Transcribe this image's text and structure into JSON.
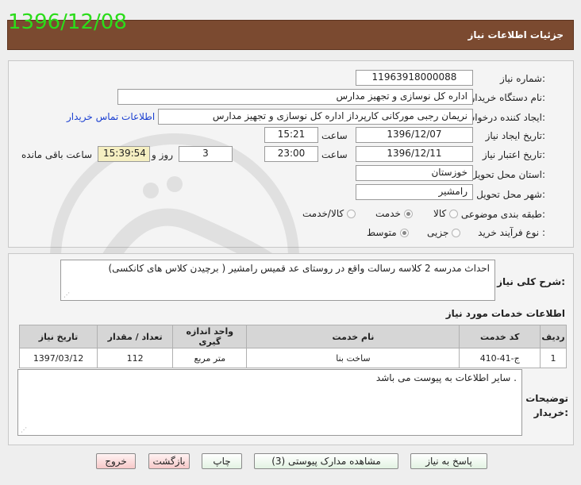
{
  "header": {
    "title": "جزئیات اطلاعات نیاز",
    "date_stamp": "1396/12/08"
  },
  "form": {
    "need_number": {
      "label": "شماره نیاز:",
      "value": "11963918000088"
    },
    "buyer_org": {
      "label": "نام دستگاه خریدار:",
      "value": "اداره کل نوسازی و تجهیز مدارس"
    },
    "requester": {
      "label": "ایجاد کننده درخواست:",
      "value": "نریمان رجبی مورکانی کارپرداز اداره کل نوسازی و تجهیز مدارس",
      "contact_link": "اطلاعات تماس خریدار"
    },
    "created": {
      "label": "تاریخ ایجاد نیاز:",
      "date": "1396/12/07",
      "time_label": "ساعت",
      "time": "15:21"
    },
    "validity": {
      "label": "تاریخ اعتبار نیاز:",
      "date": "1396/12/11",
      "time_label": "ساعت",
      "time": "23:00",
      "days": "3",
      "days_label": "روز و",
      "remaining": "15:39:54",
      "remaining_label": "ساعت باقی مانده"
    },
    "province": {
      "label": "استان محل تحویل:",
      "value": "خوزستان"
    },
    "city": {
      "label": "شهر محل تحویل:",
      "value": "رامشیر"
    },
    "category": {
      "label": "طبقه بندی موضوعی:",
      "options": [
        "کالا",
        "خدمت",
        "کالا/خدمت"
      ],
      "selected": "خدمت"
    },
    "purchase_type": {
      "label": "نوع فرآیند خرید :",
      "options": [
        "جزیی",
        "متوسط"
      ],
      "selected": "متوسط"
    }
  },
  "description": {
    "label": "شرح کلی نیاز:",
    "value": "احداث مدرسه 2 کلاسه  رسالت واقع در روستای عد قمیس رامشیر ( برچیدن کلاس های کانکسی)"
  },
  "services": {
    "title": "اطلاعات خدمات مورد نیاز",
    "columns": [
      "ردیف",
      "کد خدمت",
      "نام خدمت",
      "واحد اندازه گیری",
      "تعداد / مقدار",
      "تاریخ نیاز"
    ],
    "rows": [
      {
        "row": "1",
        "code": "ج-41-410",
        "name": "ساخت بنا",
        "unit": "متر مربع",
        "qty": "112",
        "date": "1397/03/12"
      }
    ]
  },
  "notes": {
    "label_line1": "توضیحات",
    "label_line2": "خریدار:",
    "value": "سایر اطلاعات به پیوست می باشد ."
  },
  "buttons": {
    "reply": "پاسخ به نیاز",
    "attachments": "مشاهده مدارک پیوستی (3)",
    "print": "چاپ",
    "back": "بازگشت",
    "exit": "خروج"
  },
  "colors": {
    "header_bg": "#7b4a30",
    "date_stamp": "#2bdc1a",
    "remaining_bg": "#f5efc1",
    "link": "#1a3fd1"
  }
}
